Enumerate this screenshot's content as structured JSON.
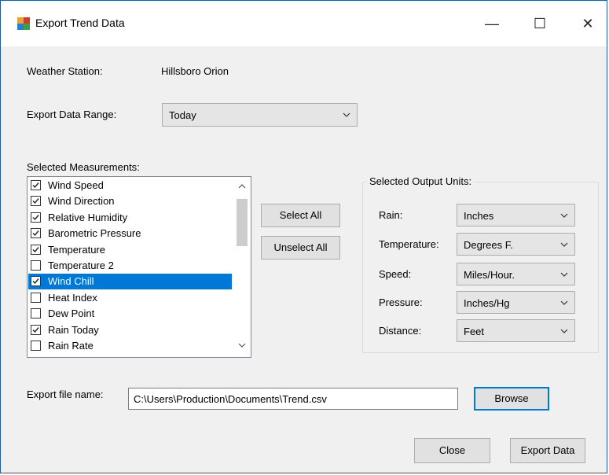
{
  "window": {
    "title": "Export Trend Data",
    "minimize_glyph": "—",
    "maximize_glyph": "☐",
    "close_glyph": "✕"
  },
  "station": {
    "label": "Weather Station:",
    "value": "Hillsboro Orion"
  },
  "range": {
    "label": "Export Data Range:",
    "value": "Today"
  },
  "measurements": {
    "label": "Selected Measurements:",
    "items": [
      {
        "label": "Wind Speed",
        "checked": true,
        "selected": false
      },
      {
        "label": "Wind Direction",
        "checked": true,
        "selected": false
      },
      {
        "label": "Relative Humidity",
        "checked": true,
        "selected": false
      },
      {
        "label": "Barometric Pressure",
        "checked": true,
        "selected": false
      },
      {
        "label": "Temperature",
        "checked": true,
        "selected": false
      },
      {
        "label": "Temperature 2",
        "checked": false,
        "selected": false
      },
      {
        "label": "Wind Chill",
        "checked": true,
        "selected": true
      },
      {
        "label": "Heat Index",
        "checked": false,
        "selected": false
      },
      {
        "label": "Dew Point",
        "checked": false,
        "selected": false
      },
      {
        "label": "Rain Today",
        "checked": true,
        "selected": false
      },
      {
        "label": "Rain Rate",
        "checked": false,
        "selected": false
      }
    ]
  },
  "buttons": {
    "select_all": "Select All",
    "unselect_all": "Unselect All",
    "browse": "Browse",
    "close": "Close",
    "export": "Export Data"
  },
  "units": {
    "title": "Selected Output Units:",
    "rows": [
      {
        "label": "Rain:",
        "value": "Inches"
      },
      {
        "label": "Temperature:",
        "value": "Degrees F."
      },
      {
        "label": "Speed:",
        "value": "Miles/Hour."
      },
      {
        "label": "Pressure:",
        "value": "Inches/Hg"
      },
      {
        "label": "Distance:",
        "value": "Feet"
      }
    ]
  },
  "file": {
    "label": "Export file name:",
    "value": "C:\\Users\\Production\\Documents\\Trend.csv"
  },
  "colors": {
    "selection": "#0078d7",
    "window_bg": "#f0f0f0",
    "frame": "#1e5aa8"
  }
}
